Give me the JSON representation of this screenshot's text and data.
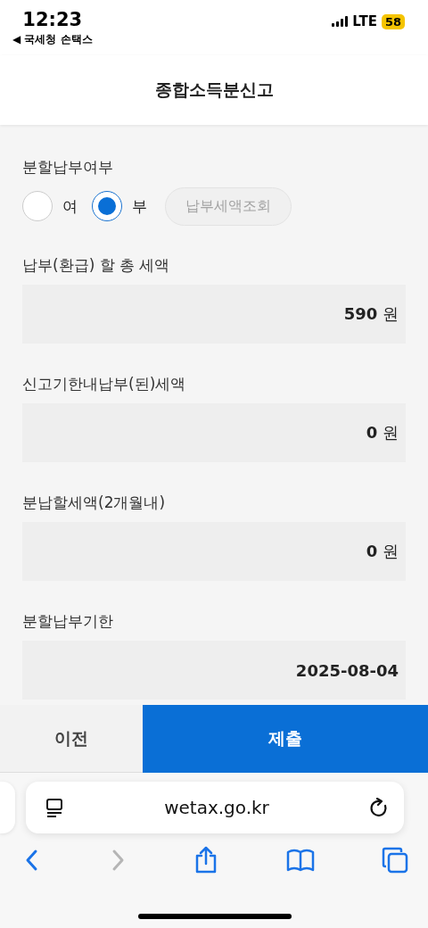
{
  "status_bar": {
    "time": "12:23",
    "back_app": "◀ 국세청 손택스",
    "network": "LTE",
    "battery": "58"
  },
  "header": {
    "title": "종합소득분신고"
  },
  "installment": {
    "label": "분할납부여부",
    "options": [
      {
        "label": "여",
        "selected": false
      },
      {
        "label": "부",
        "selected": true
      }
    ],
    "lookup_button": {
      "label": "납부세액조회",
      "disabled": true
    }
  },
  "fields": [
    {
      "label": "납부(환급) 할 총 세액",
      "value": "590",
      "unit": "원"
    },
    {
      "label": "신고기한내납부(된)세액",
      "value": "0",
      "unit": "원"
    },
    {
      "label": "분납할세액(2개월내)",
      "value": "0",
      "unit": "원"
    },
    {
      "label": "분할납부기한",
      "value": "2025-08-04"
    }
  ],
  "actions": [
    {
      "label": "이전",
      "kind": "secondary"
    },
    {
      "label": "제출",
      "kind": "primary"
    }
  ],
  "browser": {
    "url": "wetax.go.kr",
    "back_disabled": false,
    "forward_disabled": true
  }
}
